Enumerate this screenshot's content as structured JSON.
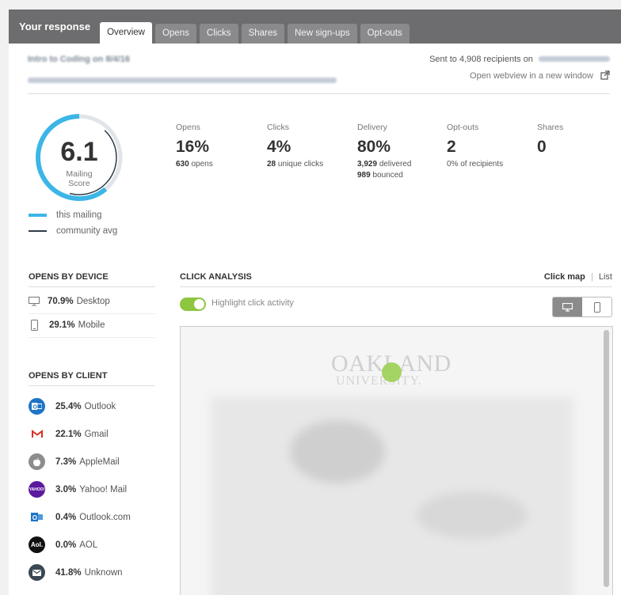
{
  "tabs": {
    "title": "Your response",
    "items": [
      "Overview",
      "Opens",
      "Clicks",
      "Shares",
      "New sign-ups",
      "Opt-outs"
    ]
  },
  "header": {
    "campaign": "Intro to Coding on 8/4/16",
    "sent_prefix": "Sent to 4,908 recipients on",
    "webview": "Open webview in a new window"
  },
  "score": {
    "value": "6.1",
    "label_line1": "Mailing",
    "label_line2": "Score",
    "fraction": 0.61,
    "legend_mailing": "this mailing",
    "legend_community": "community avg"
  },
  "stats": [
    {
      "label": "Opens",
      "value": "16%",
      "sub_num": "630",
      "sub_text": "opens",
      "sub2_num": "",
      "sub2_text": ""
    },
    {
      "label": "Clicks",
      "value": "4%",
      "sub_num": "28",
      "sub_text": "unique clicks",
      "sub2_num": "",
      "sub2_text": ""
    },
    {
      "label": "Delivery",
      "value": "80%",
      "sub_num": "3,929",
      "sub_text": "delivered",
      "sub2_num": "989",
      "sub2_text": "bounced"
    },
    {
      "label": "Opt-outs",
      "value": "2",
      "sub_num": "",
      "sub_text": "0% of recipients",
      "sub2_num": "",
      "sub2_text": ""
    },
    {
      "label": "Shares",
      "value": "0",
      "sub_num": "",
      "sub_text": "",
      "sub2_num": "",
      "sub2_text": ""
    }
  ],
  "devices": {
    "title": "OPENS BY DEVICE",
    "items": [
      {
        "pct": "70.9%",
        "label": "Desktop",
        "icon": "desktop-icon"
      },
      {
        "pct": "29.1%",
        "label": "Mobile",
        "icon": "mobile-icon"
      }
    ]
  },
  "clients": {
    "title": "OPENS BY CLIENT",
    "items": [
      {
        "pct": "25.4%",
        "label": "Outlook",
        "color": "#1e74c6",
        "glyph": "O",
        "icon": "outlook-icon"
      },
      {
        "pct": "22.1%",
        "label": "Gmail",
        "color": "#ffffff",
        "glyph": "M",
        "icon": "gmail-icon"
      },
      {
        "pct": "7.3%",
        "label": "AppleMail",
        "color": "#8d8d8d",
        "glyph": "",
        "icon": "apple-icon"
      },
      {
        "pct": "3.0%",
        "label": "Yahoo! Mail",
        "color": "#5b1a9e",
        "glyph": "YAHOO!",
        "icon": "yahoo-icon"
      },
      {
        "pct": "0.4%",
        "label": "Outlook.com",
        "color": "#1e74c6",
        "glyph": "O",
        "icon": "outlook-com-icon"
      },
      {
        "pct": "0.0%",
        "label": "AOL",
        "color": "#111111",
        "glyph": "Aol.",
        "icon": "aol-icon"
      },
      {
        "pct": "41.8%",
        "label": "Unknown",
        "color": "#3a4754",
        "glyph": "✉",
        "icon": "envelope-icon"
      }
    ]
  },
  "click_analysis": {
    "title": "CLICK ANALYSIS",
    "click_map": "Click map",
    "separator": "|",
    "list": "List",
    "highlight": "Highlight click activity",
    "logo_line1": "OAKLAND",
    "logo_line2": "UNIVERSITY."
  },
  "colors": {
    "accent_blue": "#3bb6e6",
    "community_line": "#2f3b4a",
    "toggle_green": "#8ec63f",
    "tab_bar": "#6d6d6f"
  }
}
